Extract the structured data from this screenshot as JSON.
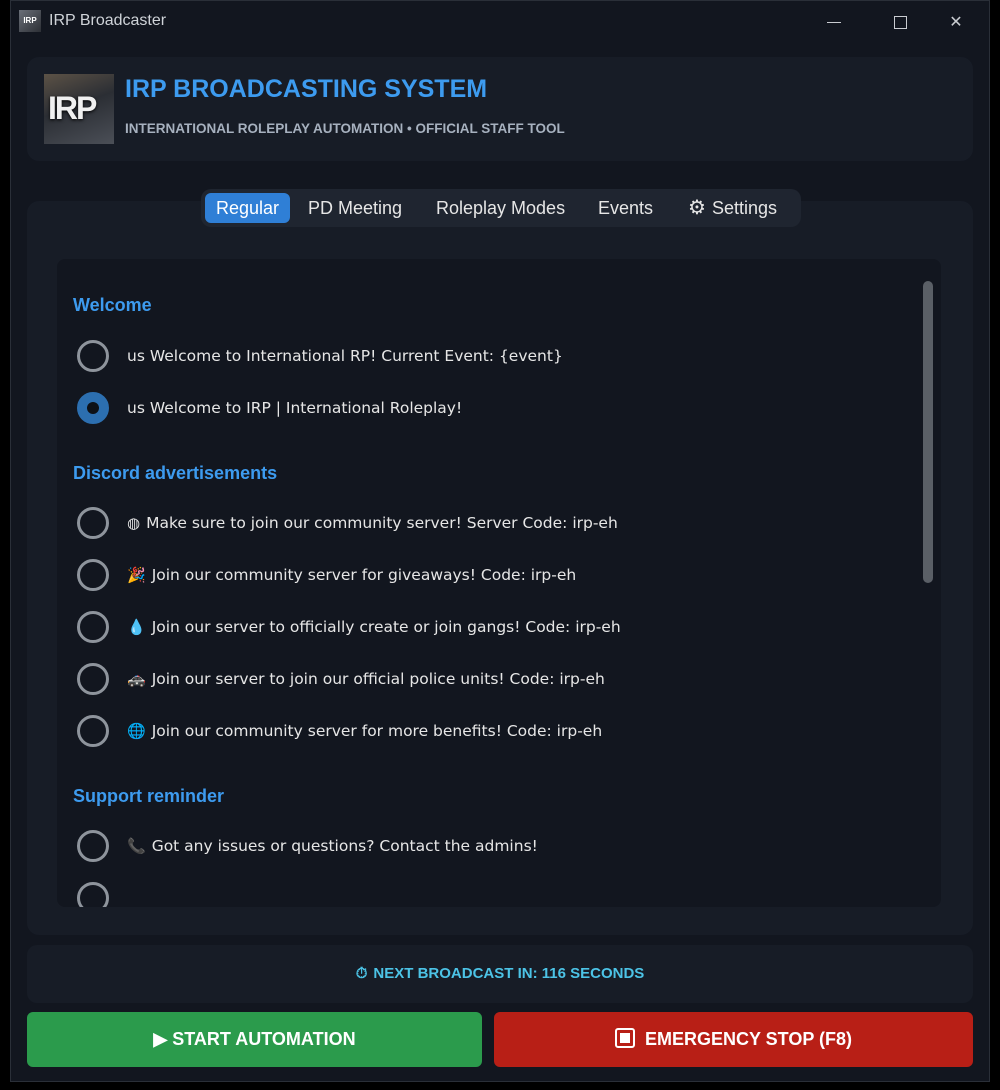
{
  "window": {
    "title": "IRP Broadcaster",
    "icon_text": "IRP",
    "minimize_icon": "minimize-icon",
    "maximize_icon": "maximize-icon",
    "close_glyph": "✕"
  },
  "header": {
    "logo_text": "IRP",
    "title": "IRP BROADCASTING SYSTEM",
    "subtitle": "INTERNATIONAL ROLEPLAY AUTOMATION • OFFICIAL STAFF TOOL"
  },
  "tabs": [
    {
      "label": "Regular",
      "active": true
    },
    {
      "label": "PD Meeting",
      "active": false
    },
    {
      "label": "Roleplay Modes",
      "active": false
    },
    {
      "label": "Events",
      "active": false
    },
    {
      "label": "Settings",
      "active": false,
      "icon": "gear-icon"
    }
  ],
  "sections": [
    {
      "title": "Welcome",
      "options": [
        {
          "icon": "",
          "label": "us Welcome to International RP! Current Event: {event}",
          "checked": false
        },
        {
          "icon": "",
          "label": "us Welcome to IRP | International Roleplay!",
          "checked": true
        }
      ]
    },
    {
      "title": "Discord advertisements",
      "options": [
        {
          "icon": "◍",
          "label": "Make sure to join our community server! Server Code: irp-eh",
          "checked": false
        },
        {
          "icon": "🎉",
          "label": "Join our community server for giveaways! Code: irp-eh",
          "checked": false
        },
        {
          "icon": "💧",
          "label": "Join our server to officially create or join gangs! Code: irp-eh",
          "checked": false
        },
        {
          "icon": "🚓",
          "label": "Join our server to join our official police units! Code: irp-eh",
          "checked": false
        },
        {
          "icon": "🌐",
          "label": "Join our community server for more benefits! Code: irp-eh",
          "checked": false
        }
      ]
    },
    {
      "title": "Support reminder",
      "options": [
        {
          "icon": "📞",
          "label": "Got any issues or questions? Contact the admins!",
          "checked": false
        },
        {
          "icon": "",
          "label": "",
          "checked": false
        }
      ]
    }
  ],
  "status": {
    "icon": "⏱",
    "text": "NEXT BROADCAST IN: 116 SECONDS"
  },
  "buttons": {
    "start_label": "▶ START AUTOMATION",
    "stop_label": "EMERGENCY STOP (F8)"
  },
  "colors": {
    "accent": "#3d9bef",
    "start": "#2b9b4c",
    "stop": "#b81f16",
    "status": "#4cc3e6"
  }
}
